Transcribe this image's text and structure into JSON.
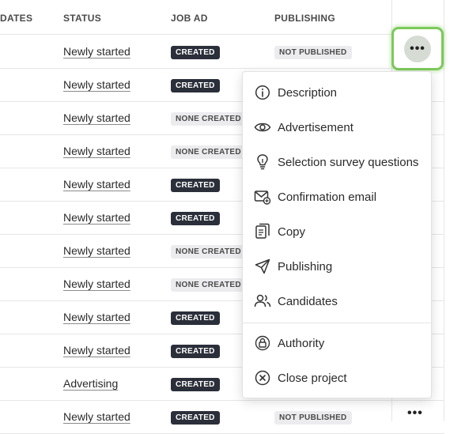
{
  "columns": {
    "dates": "DATES",
    "status": "STATUS",
    "job_ad": "JOB AD",
    "publishing": "PUBLISHING"
  },
  "rows": [
    {
      "status": "Newly started",
      "job_ad": "CREATED",
      "job_ad_style": "dark",
      "publishing": "NOT PUBLISHED"
    },
    {
      "status": "Newly started",
      "job_ad": "CREATED",
      "job_ad_style": "dark",
      "publishing": ""
    },
    {
      "status": "Newly started",
      "job_ad": "NONE CREATED",
      "job_ad_style": "light",
      "publishing": ""
    },
    {
      "status": "Newly started",
      "job_ad": "NONE CREATED",
      "job_ad_style": "light",
      "publishing": ""
    },
    {
      "status": "Newly started",
      "job_ad": "CREATED",
      "job_ad_style": "dark",
      "publishing": ""
    },
    {
      "status": "Newly started",
      "job_ad": "CREATED",
      "job_ad_style": "dark",
      "publishing": ""
    },
    {
      "status": "Newly started",
      "job_ad": "NONE CREATED",
      "job_ad_style": "light",
      "publishing": ""
    },
    {
      "status": "Newly started",
      "job_ad": "NONE CREATED",
      "job_ad_style": "light",
      "publishing": ""
    },
    {
      "status": "Newly started",
      "job_ad": "CREATED",
      "job_ad_style": "dark",
      "publishing": ""
    },
    {
      "status": "Newly started",
      "job_ad": "CREATED",
      "job_ad_style": "dark",
      "publishing": ""
    },
    {
      "status": "Advertising",
      "job_ad": "CREATED",
      "job_ad_style": "dark",
      "publishing": ""
    },
    {
      "status": "Newly started",
      "job_ad": "CREATED",
      "job_ad_style": "dark",
      "publishing": "NOT PUBLISHED"
    }
  ],
  "more_button": {
    "label": "•••",
    "icon": "more-horizontal-icon"
  },
  "menu": {
    "items": [
      {
        "label": "Description",
        "icon": "info-icon"
      },
      {
        "label": "Advertisement",
        "icon": "eye-icon"
      },
      {
        "label": "Selection survey questions",
        "icon": "lightbulb-icon"
      },
      {
        "label": "Confirmation email",
        "icon": "mail-icon"
      },
      {
        "label": "Copy",
        "icon": "copy-icon"
      },
      {
        "label": "Publishing",
        "icon": "send-icon"
      },
      {
        "label": "Candidates",
        "icon": "users-icon"
      },
      {
        "label": "Authority",
        "icon": "lock-icon"
      },
      {
        "label": "Close project",
        "icon": "close-circle-icon"
      }
    ]
  },
  "colors": {
    "highlight": "#7cc95a",
    "badge_dark": "#2b2f3a",
    "badge_light": "#ececef"
  }
}
